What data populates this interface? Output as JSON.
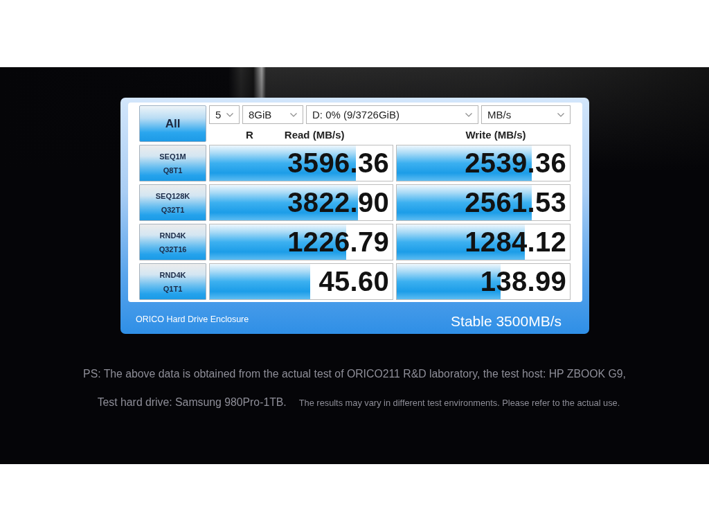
{
  "app_window": {
    "all_button": "All",
    "selectors": [
      {
        "value": "5"
      },
      {
        "value": "8GiB"
      },
      {
        "value": "D: 0% (9/3726GiB)"
      },
      {
        "value": "MB/s"
      }
    ],
    "headers": {
      "mode": "R",
      "read": "Read (MB/s)",
      "write": "Write (MB/s)"
    },
    "tests": [
      {
        "name": "SEQ1M",
        "params": "Q8T1",
        "read": {
          "value": "3596.36",
          "level": 0.8
        },
        "write": {
          "value": "2539.36",
          "level": 0.78
        }
      },
      {
        "name": "SEQ128K",
        "params": "Q32T1",
        "read": {
          "value": "3822.90",
          "level": 0.81
        },
        "write": {
          "value": "2561.53",
          "level": 0.78
        }
      },
      {
        "name": "RND4K",
        "params": "Q32T16",
        "read": {
          "value": "1226.79",
          "level": 0.745
        },
        "write": {
          "value": "1284.12",
          "level": 0.74
        }
      },
      {
        "name": "RND4K",
        "params": "Q1T1",
        "read": {
          "value": "45.60",
          "level": 0.55
        },
        "write": {
          "value": "138.99",
          "level": 0.6
        }
      }
    ],
    "footer": {
      "brand": "ORICO Hard Drive Enclosure",
      "tagline": "Stable 3500MB/s"
    }
  },
  "footnote": {
    "line_1": "PS: The above data is obtained from the actual test of ORICO211 R&D laboratory, the test host: HP ZBOOK G9,",
    "line_2": "Test hard drive: Samsung 980Pro-1TB.",
    "line_2_note": "The results may vary in different test environments. Please refer to the actual use."
  }
}
